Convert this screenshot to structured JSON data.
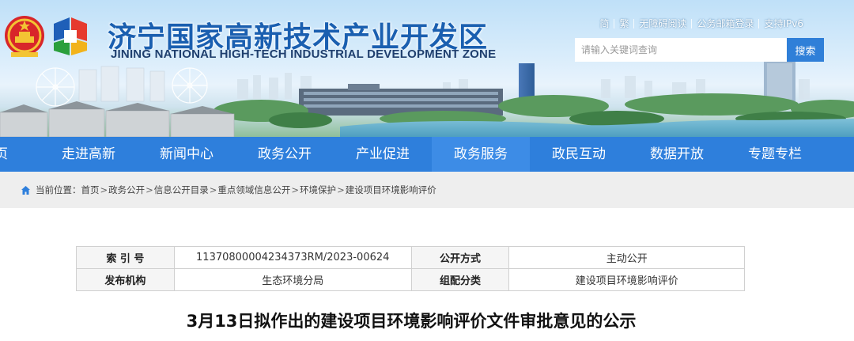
{
  "header": {
    "title": "济宁国家高新技术产业开发区",
    "subtitle": "JINING NATIONAL HIGH-TECH INDUSTRIAL DEVELOPMENT ZONE",
    "top_links": [
      "简",
      "繁",
      "无障碍阅读",
      "公务邮箱登录",
      "支持IPv6"
    ],
    "search": {
      "placeholder": "请输入关键词查询",
      "button_label": "搜索"
    },
    "icons": {
      "emblem": "national-emblem-icon",
      "logo": "hightech-zone-logo-icon"
    }
  },
  "nav": {
    "items": [
      "首页",
      "走进高新",
      "新闻中心",
      "政务公开",
      "产业促进",
      "政务服务",
      "政民互动",
      "数据开放",
      "专题专栏"
    ],
    "active_index": 5
  },
  "breadcrumb": {
    "prefix": "当前位置：",
    "items": [
      "首页",
      "政务公开",
      "信息公开目录",
      "重点领域信息公开",
      "环境保护",
      "建设项目环境影响评价"
    ],
    "separator": ">",
    "icon": "home-icon"
  },
  "info_table": {
    "rows": [
      {
        "label1": "索 引 号",
        "value1": "11370800004234373RM/2023-00624",
        "label2": "公开方式",
        "value2": "主动公开"
      },
      {
        "label1": "发布机构",
        "value1": "生态环境分局",
        "label2": "组配分类",
        "value2": "建设项目环境影响评价"
      }
    ]
  },
  "article": {
    "title": "3月13日拟作出的建设项目环境影响评价文件审批意见的公示"
  },
  "colors": {
    "nav_bg": "#2e7fdc",
    "nav_active": "#3d8ce6",
    "title_blue": "#1a5fb0",
    "search_button": "#2f7fd8",
    "breadcrumb_bg": "#eeeeee"
  }
}
